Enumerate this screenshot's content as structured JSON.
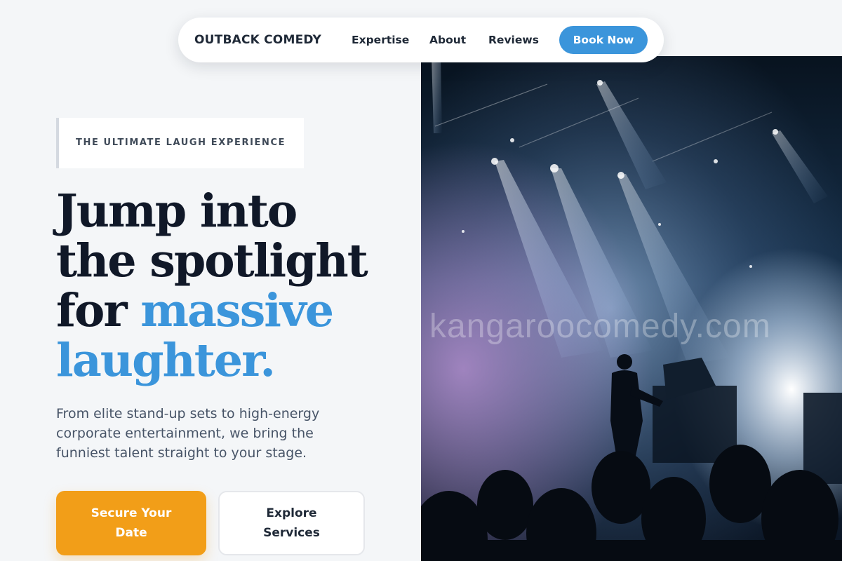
{
  "nav": {
    "brand": "OUTBACK COMEDY",
    "links": [
      "Expertise",
      "About",
      "Reviews"
    ],
    "cta": "Book Now"
  },
  "hero": {
    "eyebrow": "THE ULTIMATE LAUGH EXPERIENCE",
    "headline_line1": "Jump into",
    "headline_line2": "the spotlight",
    "headline_line3_prefix": "for ",
    "headline_accent_1": "massive",
    "headline_accent_2": "laughter.",
    "subcopy": "From elite stand-up sets to high-energy corporate entertainment, we bring the funniest talent straight to your stage.",
    "primary_button_line1": "Secure Your",
    "primary_button_line2": "Date",
    "secondary_button_line1": "Explore",
    "secondary_button_line2": "Services"
  },
  "image": {
    "watermark": "kangaroocomedy.com"
  },
  "colors": {
    "accent_blue": "#3b95db",
    "cta_orange": "#f29e18",
    "heading": "#101828",
    "page_background": "#f4f6f8"
  }
}
